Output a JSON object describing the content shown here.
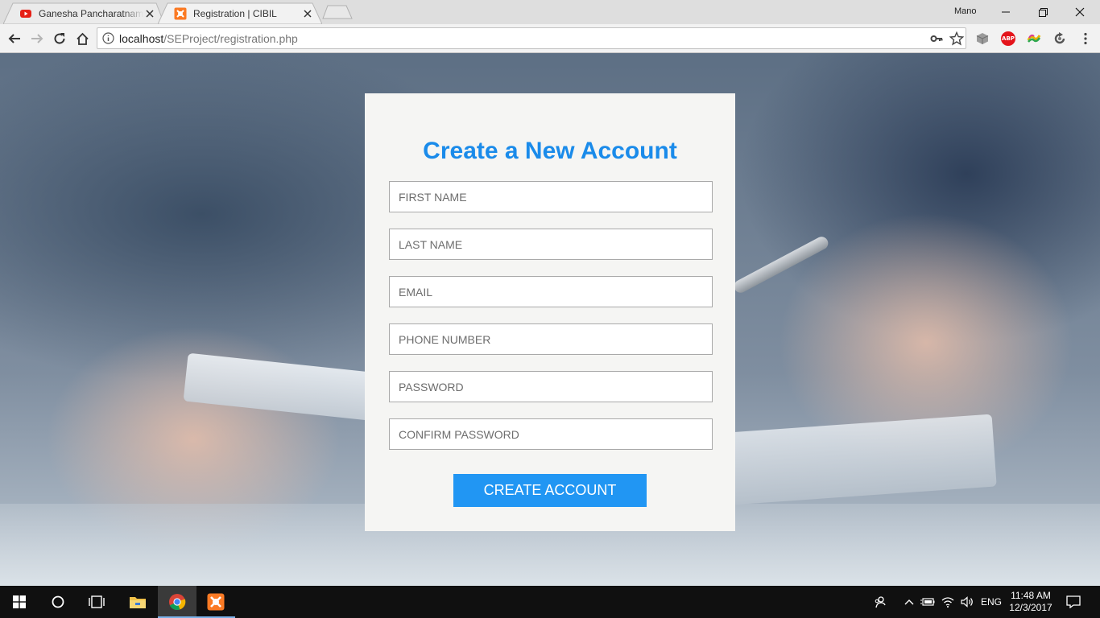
{
  "browser": {
    "tabs": [
      {
        "title": "Ganesha Pancharatnam -",
        "icon": "youtube-icon"
      },
      {
        "title": "Registration | CIBIL",
        "icon": "xampp-icon"
      }
    ],
    "profile": "Mano",
    "url_host": "localhost",
    "url_path": "/SEProject/registration.php",
    "extensions": [
      "cube-extension-icon",
      "adblock-plus-icon",
      "color-extension-icon",
      "sync-extension-icon"
    ],
    "abp_label": "ABP"
  },
  "form": {
    "heading": "Create a New Account",
    "fields": [
      {
        "placeholder": "FIRST NAME"
      },
      {
        "placeholder": "LAST NAME"
      },
      {
        "placeholder": "EMAIL"
      },
      {
        "placeholder": "PHONE NUMBER"
      },
      {
        "placeholder": "PASSWORD"
      },
      {
        "placeholder": "CONFIRM PASSWORD"
      }
    ],
    "submit_label": "CREATE ACCOUNT",
    "accent_color": "#1a8bea",
    "button_color": "#2196f3"
  },
  "taskbar": {
    "language": "ENG",
    "time": "11:48 AM",
    "date": "12/3/2017"
  }
}
